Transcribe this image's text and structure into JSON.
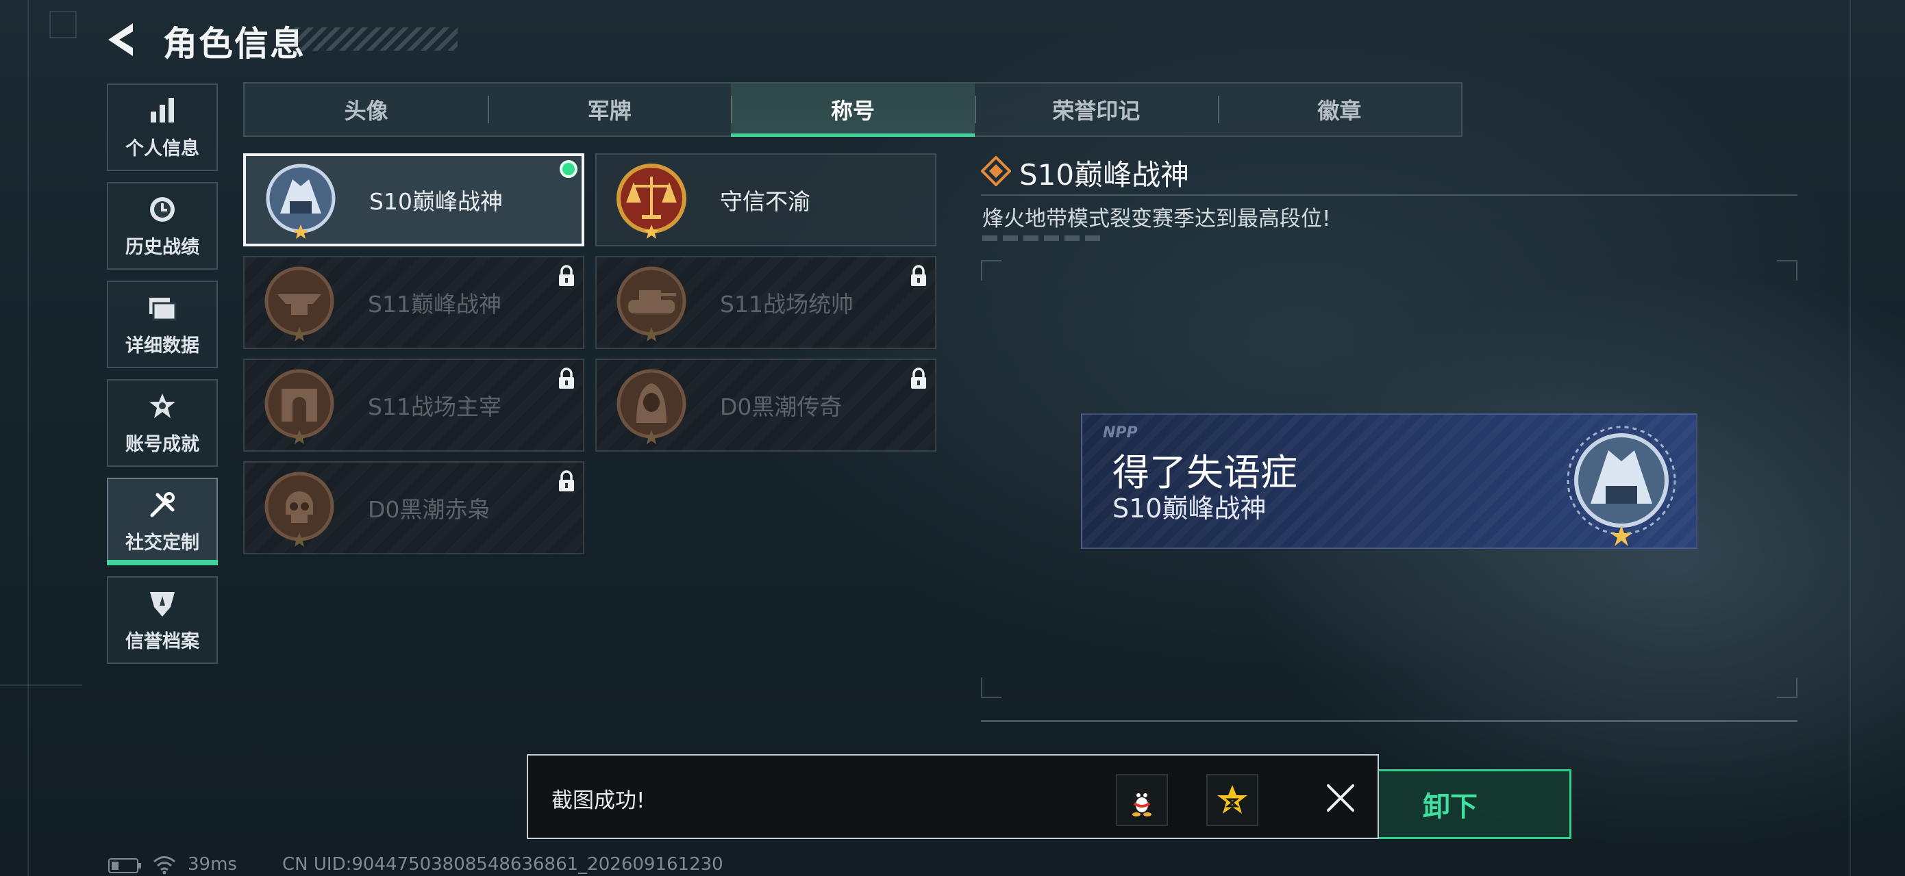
{
  "header": {
    "title": "角色信息"
  },
  "sidebar": {
    "items": [
      {
        "label": "个人信息",
        "icon": "bar-chart-icon"
      },
      {
        "label": "历史战绩",
        "icon": "clock-icon"
      },
      {
        "label": "详细数据",
        "icon": "folder-icon"
      },
      {
        "label": "账号成就",
        "icon": "achievement-icon"
      },
      {
        "label": "社交定制",
        "icon": "tools-icon",
        "active": true
      },
      {
        "label": "信誉档案",
        "icon": "shield-icon"
      }
    ]
  },
  "tabs": [
    {
      "label": "头像"
    },
    {
      "label": "军牌"
    },
    {
      "label": "称号",
      "active": true
    },
    {
      "label": "荣誉印记"
    },
    {
      "label": "徽章"
    }
  ],
  "titles": [
    {
      "name": "S10巅峰战神",
      "medal": "s10-peak-medal-icon",
      "selected": true,
      "equipped": true,
      "locked": false
    },
    {
      "name": "守信不渝",
      "medal": "scales-medal-icon",
      "selected": false,
      "equipped": false,
      "locked": false
    },
    {
      "name": "S11巅峰战神",
      "medal": "anvil-medal-icon",
      "locked": true
    },
    {
      "name": "S11战场统帅",
      "medal": "tank-medal-icon",
      "locked": true
    },
    {
      "name": "S11战场主宰",
      "medal": "arch-medal-icon",
      "locked": true
    },
    {
      "name": "D0黑潮传奇",
      "medal": "hooded-medal-icon",
      "locked": true
    },
    {
      "name": "D0黑潮赤枭",
      "medal": "skull-medal-icon",
      "locked": true
    }
  ],
  "detail": {
    "title": "S10巅峰战神",
    "description": "烽火地带模式裂变赛季达到最高段位!"
  },
  "banner": {
    "player_name": "得了失语症",
    "title": "S10巅峰战神",
    "logo_text": "NPP"
  },
  "unequip_button": {
    "label": "卸下"
  },
  "toast": {
    "message": "截图成功!"
  },
  "status_bar": {
    "ping": "39ms",
    "uid": "CN UID:904475038085486368​61_202609161230"
  },
  "colors": {
    "accent": "#3fd39a",
    "equipped": "#2fe08f"
  }
}
